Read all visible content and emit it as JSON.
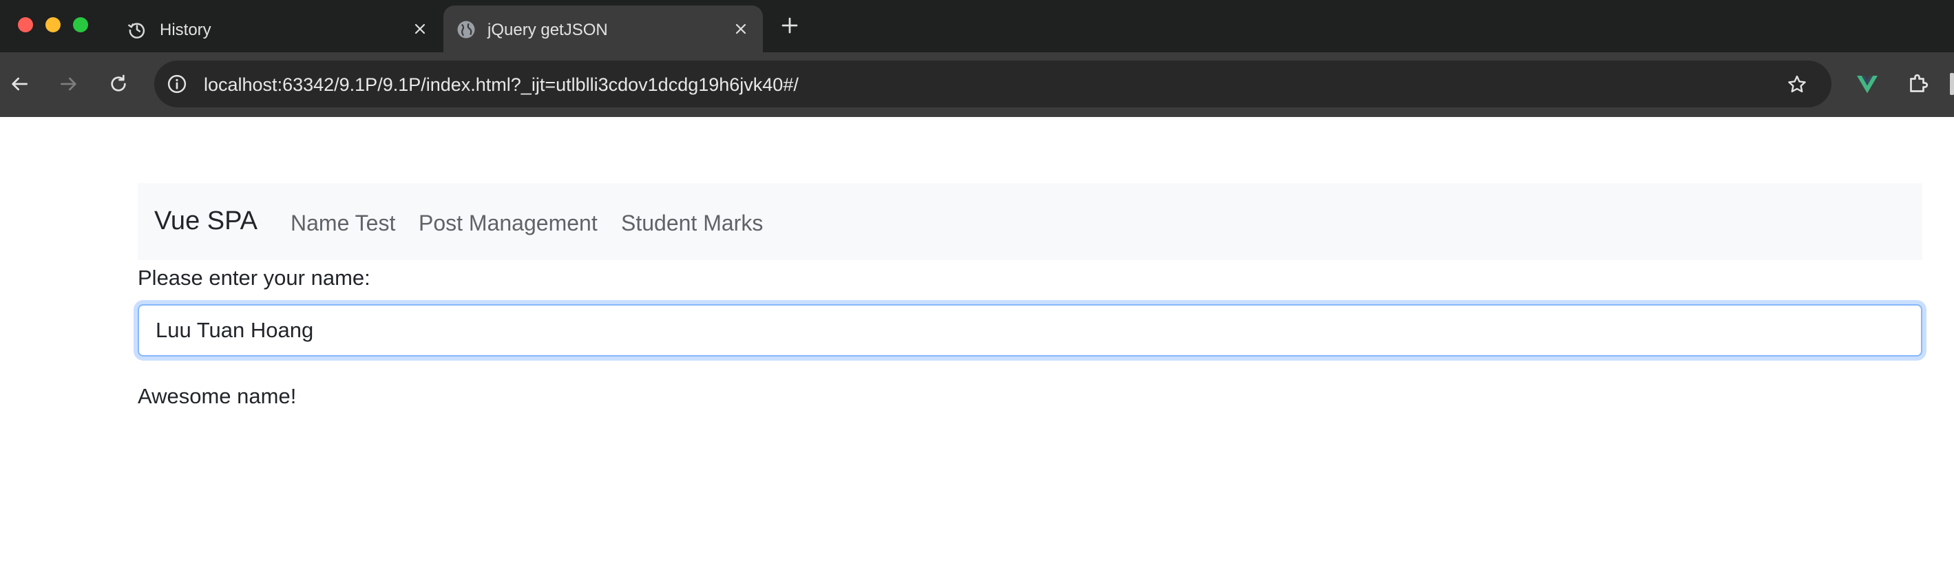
{
  "browser": {
    "tabs": [
      {
        "title": "History",
        "icon": "history-icon",
        "active": false
      },
      {
        "title": "jQuery getJSON",
        "icon": "globe-icon",
        "active": true
      }
    ],
    "url": "localhost:63342/9.1P/9.1P/index.html?_ijt=utlblli3cdov1dcdg19h6jvk40#/",
    "colors": {
      "tabstrip": "#1f2020",
      "toolbar": "#3c3c3c",
      "omnibox": "#282828",
      "vue_green": "#42b883"
    }
  },
  "app": {
    "brand": "Vue SPA",
    "nav_links": [
      "Name Test",
      "Post Management",
      "Student Marks"
    ],
    "prompt_label": "Please enter your name:",
    "name_value": "Luu Tuan Hoang",
    "result": "Awesome name!",
    "colors": {
      "navbar_bg": "#f8f9fa",
      "focus_border": "#86b7fe",
      "text": "#212529"
    }
  }
}
